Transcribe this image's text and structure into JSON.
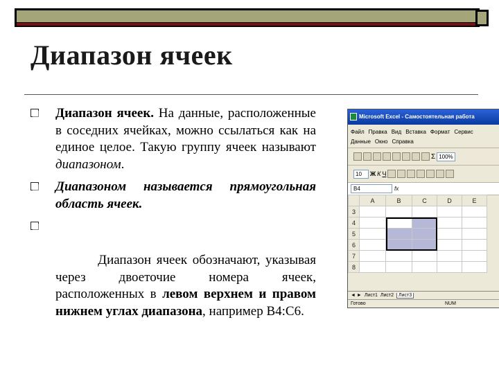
{
  "slide": {
    "title": "Диапазон ячеек"
  },
  "bullets": {
    "b1_bold": "Диапазон ячеек.",
    "b1_text": " На данные, расположенные в соседних ячейках, можно ссылаться как на единое целое. Такую группу ячеек называют ",
    "b1_italic": "диапазоном",
    "b1_end": ".",
    "b2": "Диапазоном называется прямоугольная область ячеек.",
    "b3_text": "    Диапазон ячеек обозначают, указывая через двоеточие номера ячеек, расположенных в ",
    "b3_bold": "левом верхнем и правом нижнем углах диапазона",
    "b3_end": ", например В4:С6."
  },
  "excel": {
    "window_title": "Microsoft Excel - Самостоятельная работа",
    "menu_row1": [
      "Файл",
      "Правка",
      "Вид",
      "Вставка",
      "Формат",
      "Сервис"
    ],
    "menu_row2": [
      "Данные",
      "Окно",
      "Справка"
    ],
    "zoom": "100%",
    "font_size": "10",
    "bold_btn": "Ж",
    "italic_btn": "К",
    "underline_btn": "Ч",
    "sum_btn": "Σ",
    "name_box": "B4",
    "fx": "fx",
    "columns": [
      "A",
      "B",
      "C",
      "D",
      "E"
    ],
    "rows": [
      "3",
      "4",
      "5",
      "6",
      "7",
      "8"
    ],
    "tabs": [
      "Лист1",
      "Лист2",
      "Лист3"
    ],
    "status_ready": "Готово",
    "status_num": "NUM"
  },
  "colors": {
    "olive": "#a5a57a",
    "dark_red": "#7a1010",
    "selection": "#b5b8d6"
  }
}
